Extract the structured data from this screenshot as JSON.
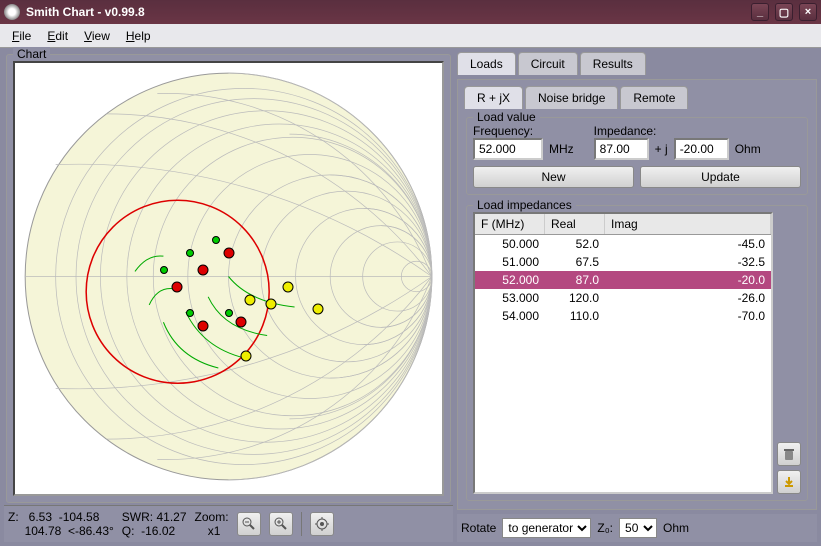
{
  "window": {
    "title": "Smith Chart - v0.99.8"
  },
  "menu": {
    "file": "File",
    "edit": "Edit",
    "view": "View",
    "help": "Help"
  },
  "chart": {
    "legend": "Chart"
  },
  "status": {
    "z_label": "Z:",
    "z1": "   6.53  -104.58",
    "z2": " 104.78  <-86.43°",
    "swr_label": "SWR:",
    "swr": " 41.27",
    "q_label": "Q:",
    "q": "  -16.02",
    "zoom_label": "Zoom:",
    "zoom": "x1"
  },
  "tabs": {
    "loads": "Loads",
    "circuit": "Circuit",
    "results": "Results"
  },
  "subtabs": {
    "rjx": "R + jX",
    "noise": "Noise bridge",
    "remote": "Remote"
  },
  "loadvalue": {
    "legend": "Load value",
    "freq_label": "Frequency:",
    "freq": "52.000",
    "freq_unit": "MHz",
    "imp_label": "Impedance:",
    "real": "87.00",
    "plus": "+ j",
    "imag": "-20.00",
    "unit": "Ohm",
    "new": "New",
    "update": "Update"
  },
  "impedances": {
    "legend": "Load impedances",
    "cols": {
      "f": "F (MHz)",
      "real": "Real",
      "imag": "Imag"
    },
    "rows": [
      {
        "f": "50.000",
        "r": "52.0",
        "i": "-45.0",
        "sel": false
      },
      {
        "f": "51.000",
        "r": "67.5",
        "i": "-32.5",
        "sel": false
      },
      {
        "f": "52.000",
        "r": "87.0",
        "i": "-20.0",
        "sel": true
      },
      {
        "f": "53.000",
        "r": "120.0",
        "i": "-26.0",
        "sel": false
      },
      {
        "f": "54.000",
        "r": "110.0",
        "i": "-70.0",
        "sel": false
      }
    ]
  },
  "bottom": {
    "rotate_label": "Rotate",
    "rotate": "to generator",
    "z0_label": "Z₀:",
    "z0": "50",
    "ohm": "Ohm"
  },
  "chart_data": {
    "type": "smith",
    "z0": 50,
    "swr_circle": 2.0,
    "loads": [
      {
        "f": 50,
        "r": 52,
        "x": -45
      },
      {
        "f": 51,
        "r": 67.5,
        "x": -32.5
      },
      {
        "f": 52,
        "r": 87,
        "x": -20
      },
      {
        "f": 53,
        "r": 120,
        "x": -26
      },
      {
        "f": 54,
        "r": 110,
        "x": -70
      }
    ]
  }
}
